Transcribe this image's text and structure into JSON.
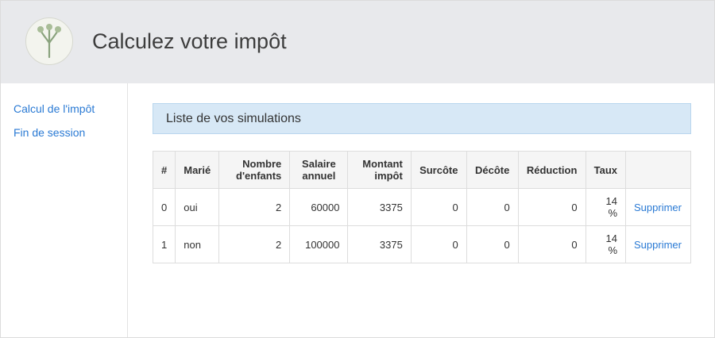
{
  "header": {
    "title": "Calculez votre impôt",
    "logo_icon": "tree-logo-icon"
  },
  "sidebar": {
    "items": [
      {
        "label": "Calcul de l'impôt"
      },
      {
        "label": "Fin de session"
      }
    ]
  },
  "panel": {
    "title": "Liste de vos simulations"
  },
  "table": {
    "columns": [
      {
        "line1": "#",
        "line2": ""
      },
      {
        "line1": "Marié",
        "line2": ""
      },
      {
        "line1": "Nombre",
        "line2": "d'enfants"
      },
      {
        "line1": "Salaire",
        "line2": "annuel"
      },
      {
        "line1": "Montant",
        "line2": "impôt"
      },
      {
        "line1": "Surcôte",
        "line2": ""
      },
      {
        "line1": "Décôte",
        "line2": ""
      },
      {
        "line1": "Réduction",
        "line2": ""
      },
      {
        "line1": "Taux",
        "line2": ""
      },
      {
        "line1": "",
        "line2": ""
      }
    ],
    "rows": [
      {
        "id": "0",
        "marie": "oui",
        "enfants": "2",
        "salaire": "60000",
        "impot": "3375",
        "surcote": "0",
        "decote": "0",
        "reduction": "0",
        "taux_value": "14",
        "taux_unit": "%",
        "action": "Supprimer"
      },
      {
        "id": "1",
        "marie": "non",
        "enfants": "2",
        "salaire": "100000",
        "impot": "3375",
        "surcote": "0",
        "decote": "0",
        "reduction": "0",
        "taux_value": "14",
        "taux_unit": "%",
        "action": "Supprimer"
      }
    ]
  },
  "colors": {
    "link": "#2a7ad4",
    "header_bg": "#e8e9ec",
    "panel_bg": "#d7e8f6"
  }
}
